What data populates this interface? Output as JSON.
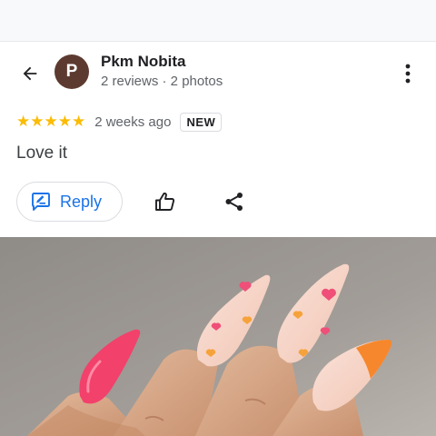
{
  "review": {
    "author_initial": "P",
    "author_name": "Pkm Nobita",
    "author_meta": "2 reviews · 2 photos",
    "stars": "★★★★★",
    "rating": 5,
    "time": "2 weeks ago",
    "badge": "NEW",
    "text": "Love it"
  },
  "actions": {
    "reply_label": "Reply"
  },
  "icons": {
    "back": "arrow-back-icon",
    "more": "more-vert-icon",
    "reply": "reply-icon",
    "like": "thumb-up-icon",
    "share": "share-icon"
  },
  "colors": {
    "accent": "#1a73e8",
    "star": "#fbbc04",
    "avatar": "#5d3a30"
  }
}
